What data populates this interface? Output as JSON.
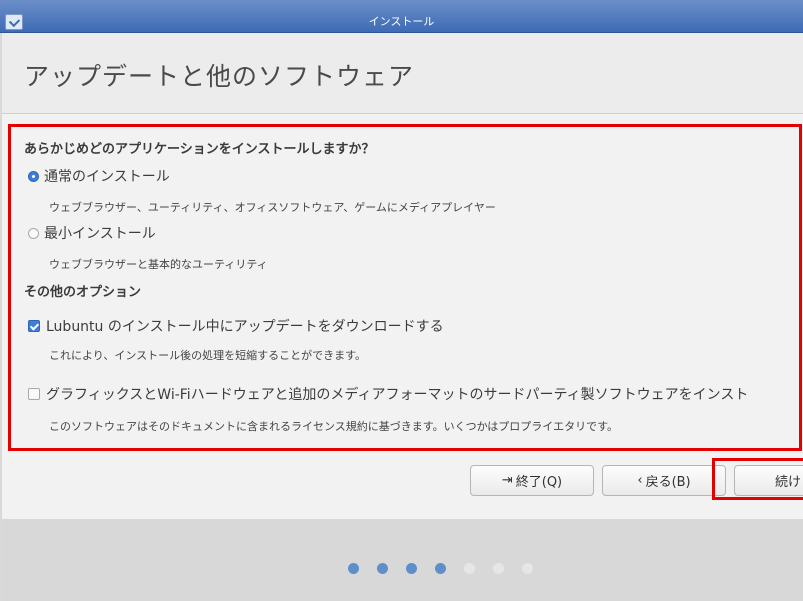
{
  "window": {
    "title": "インストール"
  },
  "header": {
    "page_title": "アップデートと他のソフトウェア"
  },
  "install_type": {
    "question": "あらかじめどのアプリケーションをインストールしますか？",
    "normal": {
      "label": "通常のインストール",
      "description": "ウェブブラウザー、ユーティリティ、オフィスソフトウェア、ゲームにメディアプレイヤー",
      "selected": true
    },
    "minimal": {
      "label": "最小インストール",
      "description": "ウェブブラウザーと基本的なユーティリティ",
      "selected": false
    }
  },
  "other_options": {
    "title": "その他のオプション",
    "download_updates": {
      "label": "Lubuntu のインストール中にアップデートをダウンロードする",
      "description": "これにより、インストール後の処理を短縮することができます。",
      "checked": true
    },
    "third_party": {
      "label": "グラフィックスとWi-Fiハードウェアと追加のメディアフォーマットのサードパーティ製ソフトウェアをインスト",
      "description": "このソフトウェアはそのドキュメントに含まれるライセンス規約に基づきます。いくつかはプロプライエタリです。",
      "checked": false
    }
  },
  "buttons": {
    "quit": "終了(Q)",
    "back": "戻る(B)",
    "continue": "続け"
  },
  "progress": {
    "total_steps": 7,
    "current_step": 4
  },
  "colors": {
    "highlight": "#e30000",
    "accent": "#3e7ed6"
  }
}
